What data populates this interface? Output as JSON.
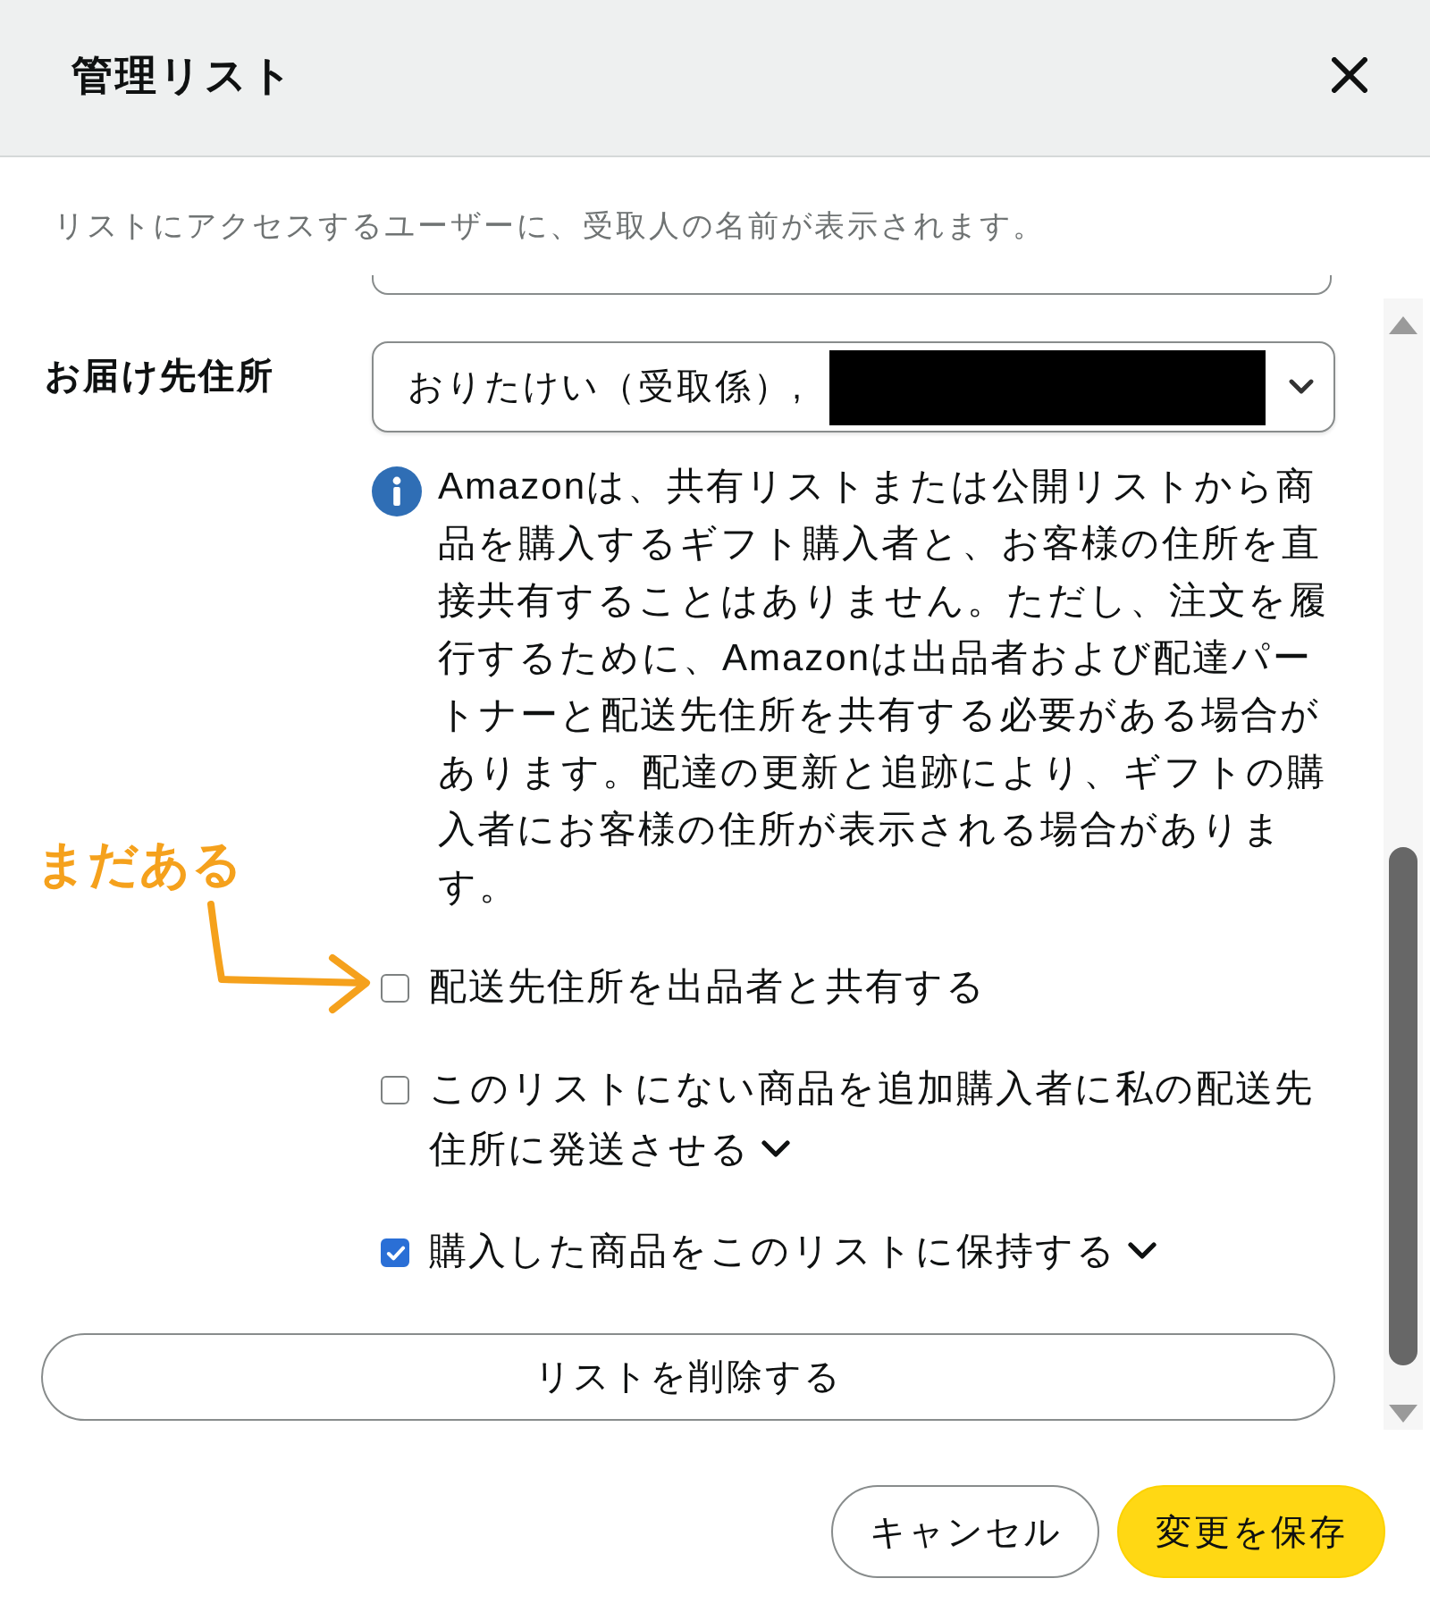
{
  "dialog": {
    "title": "管理リスト"
  },
  "hint": "リストにアクセスするユーザーに、受取人の名前が表示されます。",
  "address": {
    "label": "お届け先住所",
    "value": "おりたけい（受取係）,",
    "value_redacted": true
  },
  "notice": "Amazonは、共有リストまたは公開リストから商品を購入するギフト購入者と、お客様の住所を直接共有することはありません。ただし、注文を履行するために、Amazonは出品者および配達パートナーと配送先住所を共有する必要がある場合があります。配達の更新と追跡により、ギフトの購入者にお客様の住所が表示される場合があります。",
  "options": [
    {
      "label": "配送先住所を出品者と共有する",
      "checked": false,
      "kind": "plain"
    },
    {
      "label": "このリストにない商品を追加購入者に私の配送先住所に発送させる",
      "checked": false,
      "kind": "expandable"
    },
    {
      "label": "購入した商品をこのリストに保持する",
      "checked": true,
      "kind": "expandable"
    }
  ],
  "delete_button": "リストを削除する",
  "footer_buttons": [
    {
      "label": "キャンセル",
      "kind": "secondary"
    },
    {
      "label": "変更を保存",
      "kind": "primary"
    }
  ],
  "annotation": {
    "text": "まだある"
  }
}
